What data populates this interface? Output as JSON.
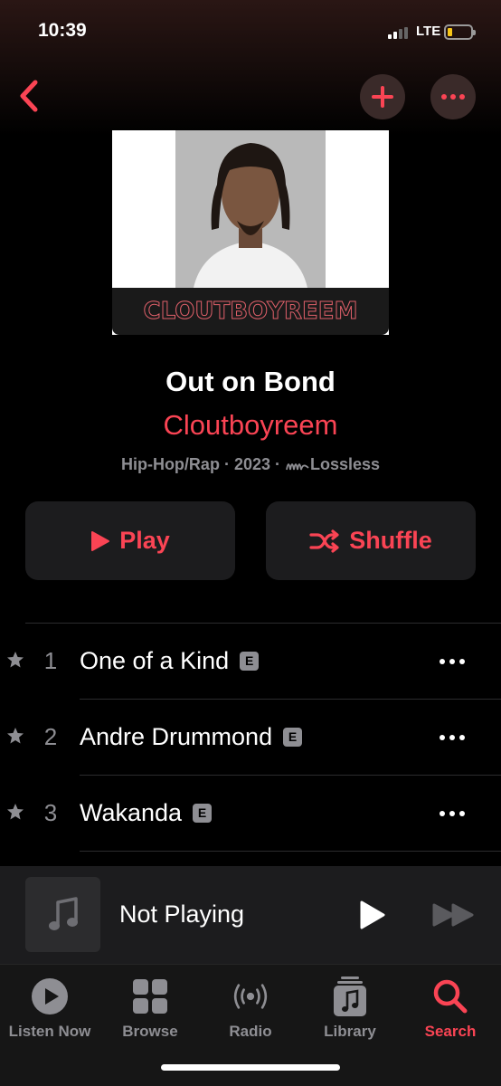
{
  "status": {
    "time": "10:39",
    "network": "LTE"
  },
  "nav": {
    "back_icon": "chevron-left-icon",
    "add_icon": "plus-icon",
    "more_icon": "ellipsis-icon"
  },
  "artwork": {
    "banner_text": "CLOUTBOYREEM"
  },
  "album": {
    "title": "Out on Bond",
    "artist": "Cloutboyreem",
    "genre": "Hip-Hop/Rap",
    "year": "2023",
    "quality": "Lossless",
    "separator": " · "
  },
  "actions": {
    "play_label": "Play",
    "shuffle_label": "Shuffle"
  },
  "tracks": [
    {
      "number": "1",
      "title": "One of a Kind",
      "explicit": "E"
    },
    {
      "number": "2",
      "title": "Andre Drummond",
      "explicit": "E"
    },
    {
      "number": "3",
      "title": "Wakanda",
      "explicit": "E"
    }
  ],
  "mini_player": {
    "title": "Not Playing"
  },
  "tabs": [
    {
      "label": "Listen Now",
      "icon": "play-circle-icon",
      "active": false
    },
    {
      "label": "Browse",
      "icon": "grid-icon",
      "active": false
    },
    {
      "label": "Radio",
      "icon": "radio-waves-icon",
      "active": false
    },
    {
      "label": "Library",
      "icon": "music-stack-icon",
      "active": false
    },
    {
      "label": "Search",
      "icon": "search-icon",
      "active": true
    }
  ],
  "colors": {
    "accent": "#fa4454",
    "secondary_text": "#8e8e93",
    "surface": "#1c1c1e"
  }
}
